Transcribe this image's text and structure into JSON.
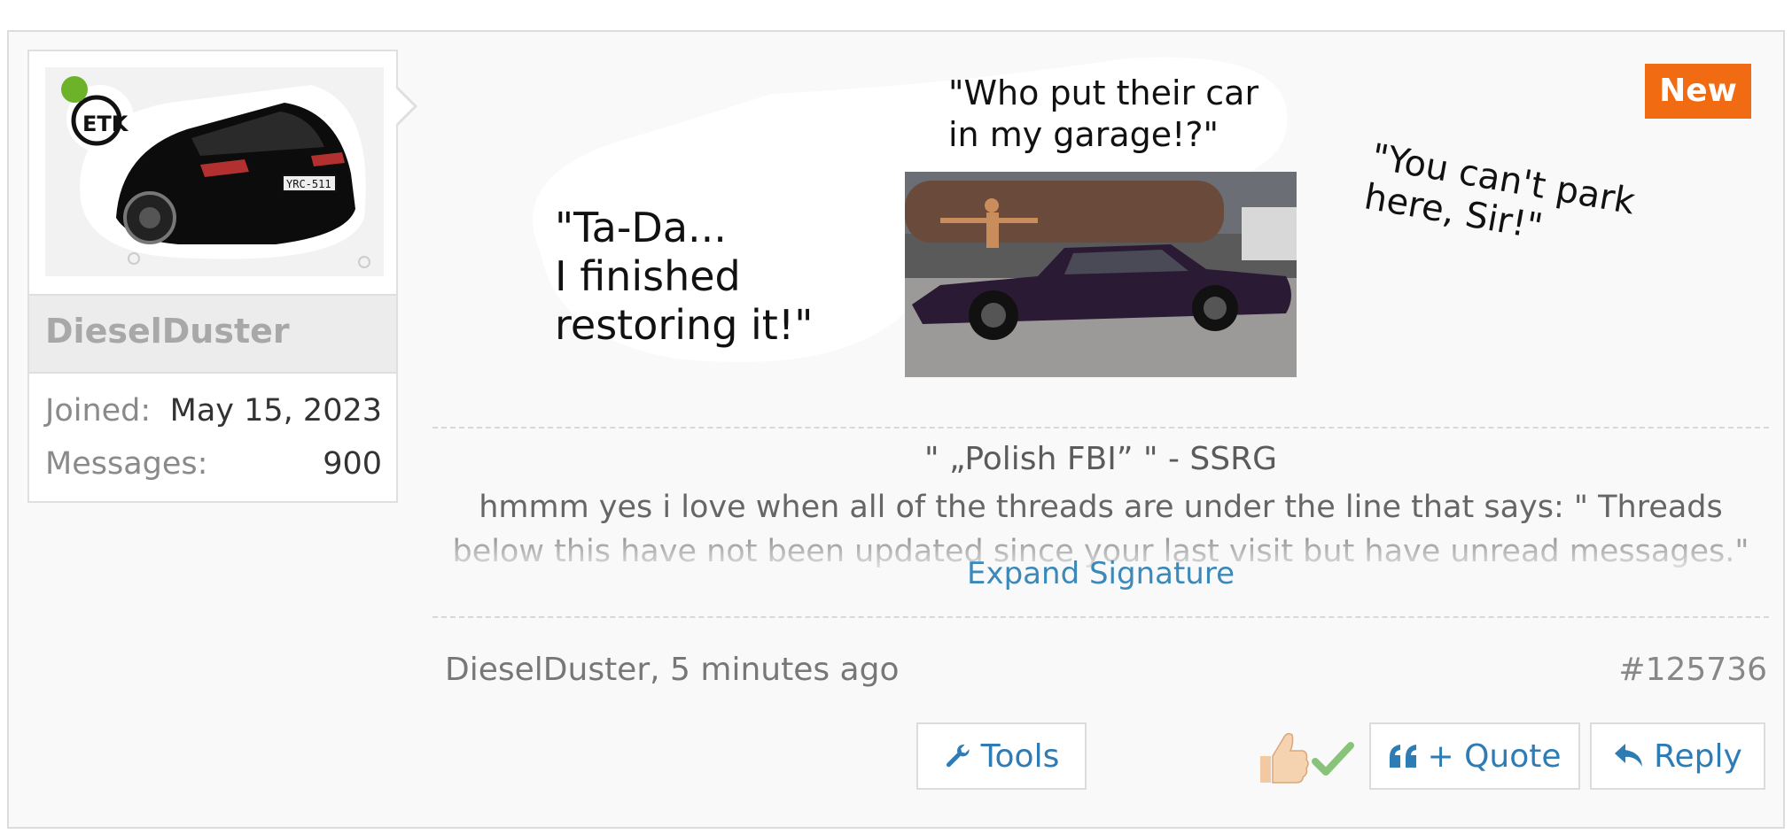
{
  "post": {
    "badge": "New",
    "author": {
      "username": "DieselDuster",
      "online": true,
      "stats": [
        {
          "label": "Joined:",
          "value": "May 15, 2023"
        },
        {
          "label": "Messages:",
          "value": "900"
        }
      ]
    },
    "captions": {
      "tada": "\"Ta-Da...\nI finished\nrestoring it!\"",
      "who": "\"Who put their car\nin my garage!?\"",
      "park": "\"You can't park\nhere, Sir!\""
    },
    "signature": {
      "quote": "\" „Polish FBI” \" - SSRG",
      "text": "hmmm yes i love when all of the threads are under the line that says: \" Threads below this have not been updated since your last visit but have unread messages.\" when you",
      "expand_label": "Expand Signature"
    },
    "meta": {
      "byline": "DieselDuster, 5 minutes ago",
      "post_number": "#125736"
    },
    "actions": {
      "tools_label": "Tools",
      "quote_label": "+ Quote",
      "reply_label": "Reply"
    },
    "icons": {
      "tools": "wrench-icon",
      "quote": "quote-icon",
      "reply": "reply-arrow-icon",
      "like": "thumbs-up-icon",
      "agree": "checkmark-icon"
    },
    "colors": {
      "badge": "#f06b11",
      "link": "#2e7cb6",
      "online": "#6cb329"
    }
  }
}
